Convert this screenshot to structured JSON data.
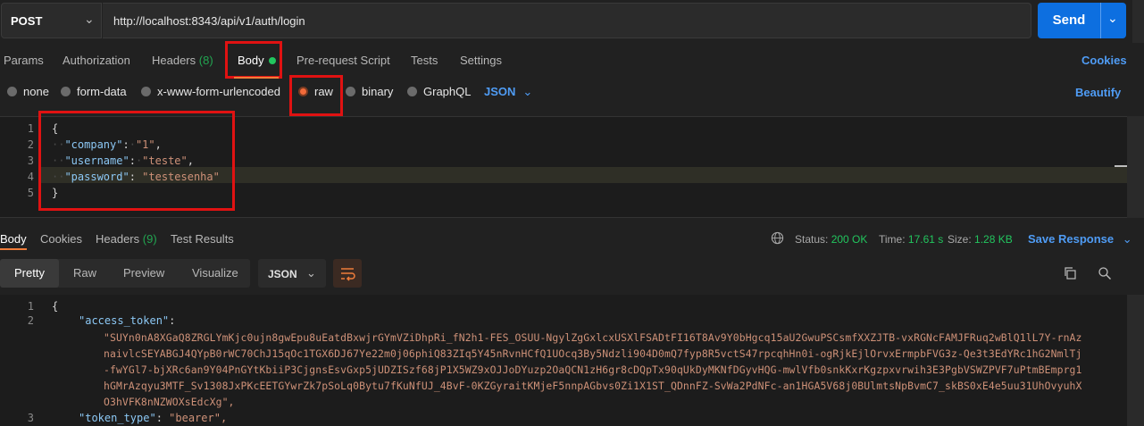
{
  "request": {
    "method": "POST",
    "url": "http://localhost:8343/api/v1/auth/login",
    "send_label": "Send"
  },
  "request_tabs": {
    "params": "Params",
    "authorization": "Authorization",
    "headers": "Headers",
    "headers_count": "(8)",
    "body": "Body",
    "pre_request": "Pre-request Script",
    "tests": "Tests",
    "settings": "Settings",
    "cookies": "Cookies"
  },
  "body_types": {
    "none": "none",
    "form_data": "form-data",
    "urlencoded": "x-www-form-urlencoded",
    "raw": "raw",
    "binary": "binary",
    "graphql": "GraphQL",
    "language": "JSON",
    "beautify": "Beautify",
    "selected": "raw"
  },
  "request_body": {
    "line_numbers": [
      "1",
      "2",
      "3",
      "4",
      "5"
    ],
    "open_brace": "{",
    "close_brace": "}",
    "company_key": "\"company\"",
    "company_val": "\"1\"",
    "username_key": "\"username\"",
    "username_val": "\"teste\"",
    "password_key": "\"password\"",
    "password_val": "\"testesenha\""
  },
  "response_tabs": {
    "body": "Body",
    "cookies": "Cookies",
    "headers": "Headers",
    "headers_count": "(9)",
    "test_results": "Test Results"
  },
  "response_status": {
    "status_label": "Status:",
    "status_value": "200 OK",
    "time_label": "Time:",
    "time_value": "17.61 s",
    "size_label": "Size:",
    "size_value": "1.28 KB",
    "save_response": "Save Response"
  },
  "response_view": {
    "pretty": "Pretty",
    "raw": "Raw",
    "preview": "Preview",
    "visualize": "Visualize",
    "format": "JSON"
  },
  "response_body": {
    "line_numbers": [
      "1",
      "2",
      "3"
    ],
    "open_brace": "{",
    "access_token_key": "\"access_token\"",
    "token_lines": [
      "\"SUYn0nA8XGaQ8ZRGLYmKjc0ujn8gwEpu8uEatdBxwjrGYmVZiDhpRi_fN2h1-FES_OSUU-NgylZgGxlcxUSXlFSADtFI16T8Av9Y0bHgcq15aU2GwuPSCsmfXXZJTB-vxRGNcFAMJFRuq2wBlQ1lL7Y-rnAz",
      "naivlcSEYABGJ4QYpB0rWC70ChJ15qOc1TGX6DJ67Ye22m0j06phiQ83ZIq5Y45nRvnHCfQ1UOcq3By5Ndzli904D0mQ7fyp8R5vctS47rpcqhHn0i-ogRjkEjlOrvxErmpbFVG3z-Qe3t3EdYRc1hG2NmlTj",
      "-fwYGl7-bjXRc6an9Y04PnGYtKbiiP3CjgnsEsvGxp5jUDZISzf68jP1X5WZ9xOJJoDYuzp2OaQCN1zH6gr8cDQpTx90qUkDyMKNfDGyvHQG-mwlVfb0snkKxrKgzpxvrwih3E3PgbVSWZPVF7uPtmBEmprg1",
      "hGMrAzqyu3MTF_Sv1308JxPKcEETGYwrZk7pSoLq0Bytu7fKuNfUJ_4BvF-0KZGyraitKMjeF5nnpAGbvs0Zi1X1ST_QDnnFZ-SvWa2PdNFc-an1HGA5V68j0BUlmtsNpBvmC7_skBS0xE4e5uu31UhOvyuhX",
      "O3hVFK8nNZWOXsEdcXg\","
    ],
    "token_type_key": "\"token_type\"",
    "token_type_val": "\"bearer\","
  },
  "colors": {
    "accent": "#f07c3a",
    "send": "#0d6fe0",
    "link": "#4f9cf5",
    "annotation": "#e01212",
    "success": "#22c55e"
  }
}
